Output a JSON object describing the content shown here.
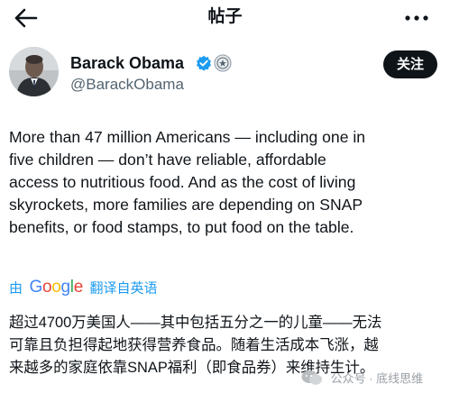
{
  "header": {
    "title": "帖子"
  },
  "author": {
    "name": "Barack Obama",
    "handle": "@BarackObama"
  },
  "follow_label": "关注",
  "tweet": {
    "lines": [
      "More than 47 million Americans — including one in",
      "five children — don’t have reliable, affordable",
      "access to nutritious food. And as the cost of living",
      "skyrockets, more families are depending on SNAP",
      "benefits, or food stamps, to put food on the table."
    ]
  },
  "translation": {
    "by_label": "由",
    "provider": "Google",
    "from_label": "翻译自英语",
    "lines": [
      "超过4700万美国人——其中包括五分之一的儿童——无法",
      "可靠且负担得起地获得营养食品。随着生活成本飞涨，越",
      "来越多的家庭依靠SNAP福利（即食品券）来维持生计。"
    ]
  },
  "watermark": {
    "text": "公众号 · 底线思维"
  },
  "icons": {
    "back": "arrow-left-icon",
    "more": "more-horizontal-icon",
    "verified": "verified-badge-icon",
    "government": "government-seal-icon",
    "watermark": "wechat-icon"
  },
  "colors": {
    "text": "#0f1419",
    "secondary": "#536471",
    "link": "#1d9bf0",
    "verified": "#1d9bf0",
    "follow_bg": "#0f1419"
  }
}
